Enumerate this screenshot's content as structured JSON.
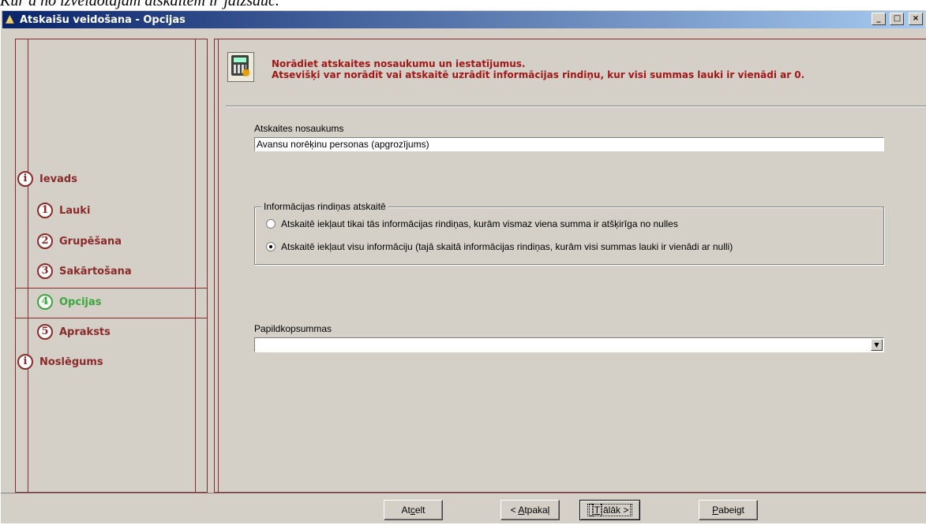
{
  "doc_caption": "Kur a no izveidotajām atskaitēm ir jāizsauc.",
  "window": {
    "title": "Atskaišu veidošana - Opcijas",
    "controls": {
      "minimize": "_",
      "maximize": "□",
      "close": "×"
    }
  },
  "nav": {
    "items": [
      {
        "badge": "i",
        "label": "Ievads",
        "active": false
      },
      {
        "badge": "1",
        "label": "Lauki",
        "active": false
      },
      {
        "badge": "2",
        "label": "Grupēšana",
        "active": false
      },
      {
        "badge": "3",
        "label": "Sakārtošana",
        "active": false
      },
      {
        "badge": "4",
        "label": "Opcijas",
        "active": true
      },
      {
        "badge": "5",
        "label": "Apraksts",
        "active": false
      },
      {
        "badge": "i",
        "label": "Noslēgums",
        "active": false
      }
    ]
  },
  "info": {
    "icon": "calculator-icon",
    "line1": "Norādiet atskaites nosaukumu un iestatījumus.",
    "line2": "Atsevišķi var norādīt vai atskaitē uzrādīt informācijas rindiņu, kur visi summas lauki ir vienādi ar 0."
  },
  "report_name": {
    "label": "Atskaites nosaukums",
    "value": "Avansu norēķinu personas (apgrozījums)"
  },
  "info_rows": {
    "title": "Informācijas rindiņas atskaitē",
    "options": [
      {
        "label": "Atskaitē iekļaut tikai tās informācijas rindiņas, kurām vismaz viena summa ir atšķirīga no nulles",
        "checked": false
      },
      {
        "label": "Atskaitē iekļaut visu informāciju (tajā skaitā informācijas rindiņas, kurām visi summas lauki ir vienādi ar nulli)",
        "checked": true
      }
    ]
  },
  "subtotals": {
    "label": "Papildkopsummas",
    "value": ""
  },
  "buttons": {
    "cancel": {
      "pre": "At",
      "accel": "c",
      "post": "elt"
    },
    "back": {
      "pre": "< ",
      "accel": "A",
      "post": "tpakaļ"
    },
    "next": {
      "pre": "",
      "accel": "T",
      "post": "ālāk >"
    },
    "finish": {
      "pre": "",
      "accel": "P",
      "post": "abeigt"
    }
  }
}
